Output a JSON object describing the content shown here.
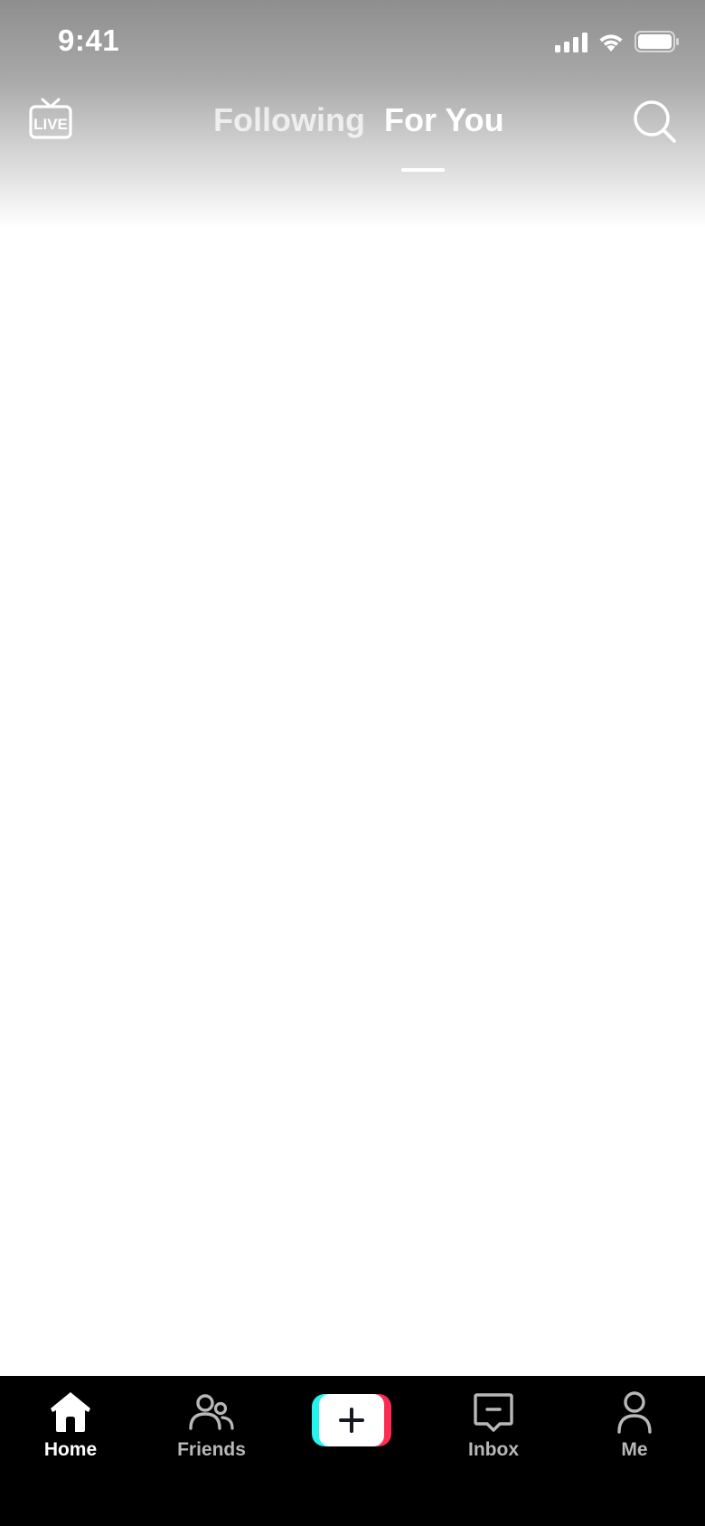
{
  "status_bar": {
    "time": "9:41",
    "icons": [
      "cellular-signal-icon",
      "wifi-icon",
      "battery-icon"
    ]
  },
  "top_nav": {
    "live_icon": "live-tv-icon",
    "live_text": "LIVE",
    "tabs": [
      {
        "label": "Following",
        "active": false
      },
      {
        "label": "For You",
        "active": true
      }
    ],
    "search_icon": "search-icon"
  },
  "bottom_nav": {
    "items": [
      {
        "label": "Home",
        "icon": "home-icon",
        "active": true
      },
      {
        "label": "Friends",
        "icon": "friends-icon",
        "active": false
      },
      {
        "label": "",
        "icon": "plus-icon",
        "active": false
      },
      {
        "label": "Inbox",
        "icon": "inbox-icon",
        "active": false
      },
      {
        "label": "Me",
        "icon": "profile-icon",
        "active": false
      }
    ]
  },
  "colors": {
    "bottom_bar_bg": "#000000",
    "create_left_accent": "#25f4ee",
    "create_right_accent": "#fe2c55",
    "active_label": "#ffffff",
    "inactive_label": "#b8b8b8"
  }
}
